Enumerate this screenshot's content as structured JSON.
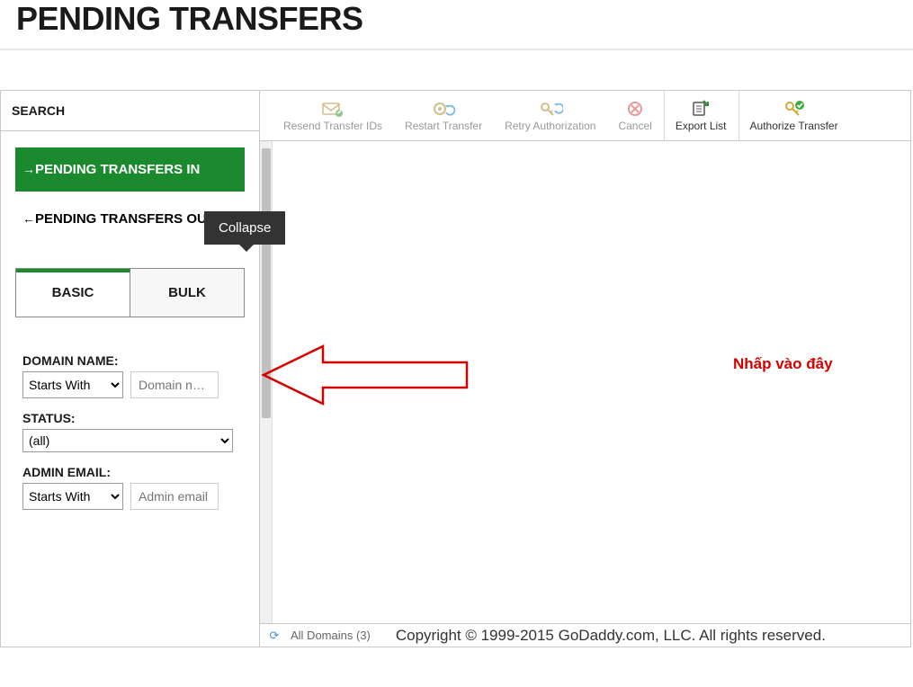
{
  "page_title": "PENDING TRANSFERS",
  "sidebar": {
    "header": "SEARCH",
    "nav": {
      "transfers_in": "PENDING TRANSFERS IN",
      "transfers_out": "PENDING TRANSFERS OUT"
    },
    "tabs": {
      "basic": "BASIC",
      "bulk": "BULK"
    },
    "form": {
      "domain_name_label": "DOMAIN NAME:",
      "domain_name_operator": "Starts With",
      "domain_name_placeholder": "Domain n…",
      "status_label": "STATUS:",
      "status_value": "(all)",
      "admin_email_label": "ADMIN EMAIL:",
      "admin_email_operator": "Starts With",
      "admin_email_placeholder": "Admin email"
    }
  },
  "toolbar": {
    "resend_ids": "Resend Transfer IDs",
    "restart": "Restart Transfer",
    "retry_auth": "Retry Authorization",
    "cancel": "Cancel",
    "export_list": "Export List",
    "authorize": "Authorize Transfer"
  },
  "tooltip": {
    "collapse": "Collapse"
  },
  "annotation": {
    "click_here": "Nhấp vào đây"
  },
  "status_bar": {
    "all_domains": "All Domains (3)",
    "copyright": "Copyright © 1999-2015 GoDaddy.com, LLC. All rights reserved."
  }
}
